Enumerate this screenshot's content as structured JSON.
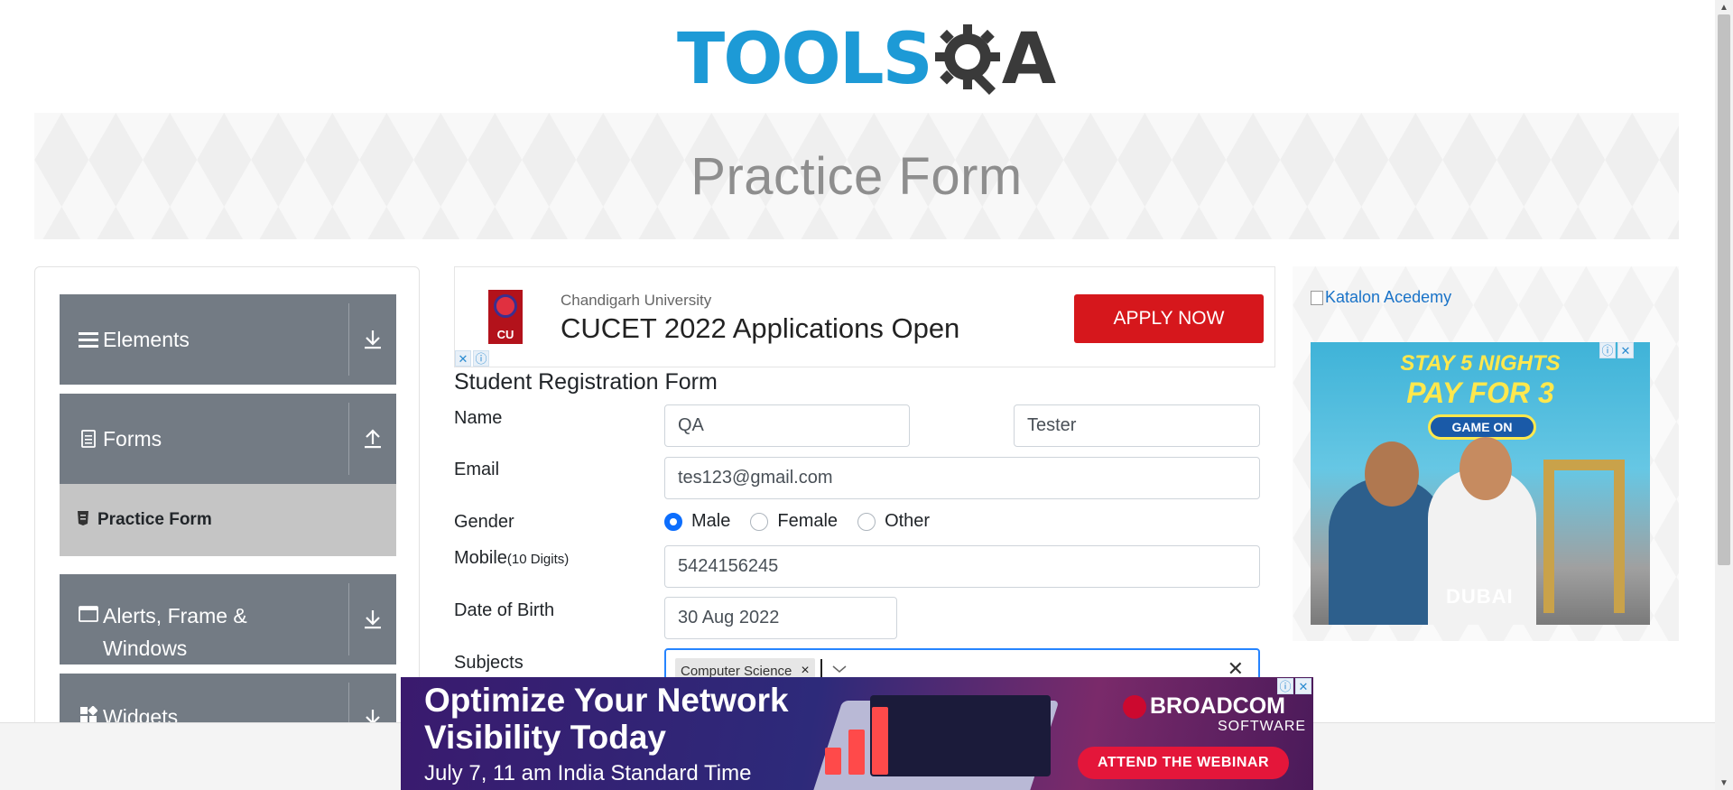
{
  "logo": {
    "text_tools": "TOOLS",
    "text_a": "A",
    "brand_color": "#1d9ad6",
    "dark_color": "#3a3a3a"
  },
  "banner": {
    "title": "Practice Form"
  },
  "sidebar": {
    "groups": [
      {
        "label": "Elements",
        "icon": "hamburger-icon",
        "toggle": "expand-icon"
      },
      {
        "label": "Forms",
        "icon": "document-icon",
        "toggle": "collapse-icon"
      },
      {
        "label": "Alerts, Frame &",
        "label2": "Windows",
        "icon": "window-icon",
        "toggle": "expand-icon"
      },
      {
        "label": "Widgets",
        "icon": "widgets-icon",
        "toggle": "expand-icon"
      }
    ],
    "active_item": {
      "label": "Practice Form",
      "icon": "form-icon"
    }
  },
  "top_ad": {
    "logo_text": "CU",
    "subtitle": "Chandigarh University",
    "headline": "CUCET 2022 Applications Open",
    "cta": "APPLY NOW",
    "cta_color": "#d6171c"
  },
  "form": {
    "title": "Student Registration Form",
    "name_label": "Name",
    "first_name": "QA",
    "last_name": "Tester",
    "email_label": "Email",
    "email": "tes123@gmail.com",
    "gender_label": "Gender",
    "gender_options": [
      "Male",
      "Female",
      "Other"
    ],
    "gender_selected": "Male",
    "mobile_label": "Mobile",
    "mobile_hint": "(10 Digits)",
    "mobile": "5424156245",
    "dob_label": "Date of Birth",
    "dob": "30 Aug 2022",
    "subjects_label": "Subjects",
    "subjects": [
      "Computer Science"
    ],
    "chip_remove": "×",
    "clear": "✕"
  },
  "right_ad": {
    "link_text": "Katalon Acedemy",
    "line1": "STAY 5 NIGHTS",
    "line2": "PAY FOR 3",
    "button": "GAME ON",
    "brand": "DUBAI"
  },
  "bottom_ad": {
    "line1": "Optimize Your Network",
    "line2": "Visibility Today",
    "line3": "July 7, 11 am India Standard Time",
    "brand": "BROADCOM",
    "brand_sub": "SOFTWARE",
    "cta": "ATTEND THE WEBINAR",
    "cta_color": "#e4163a"
  }
}
